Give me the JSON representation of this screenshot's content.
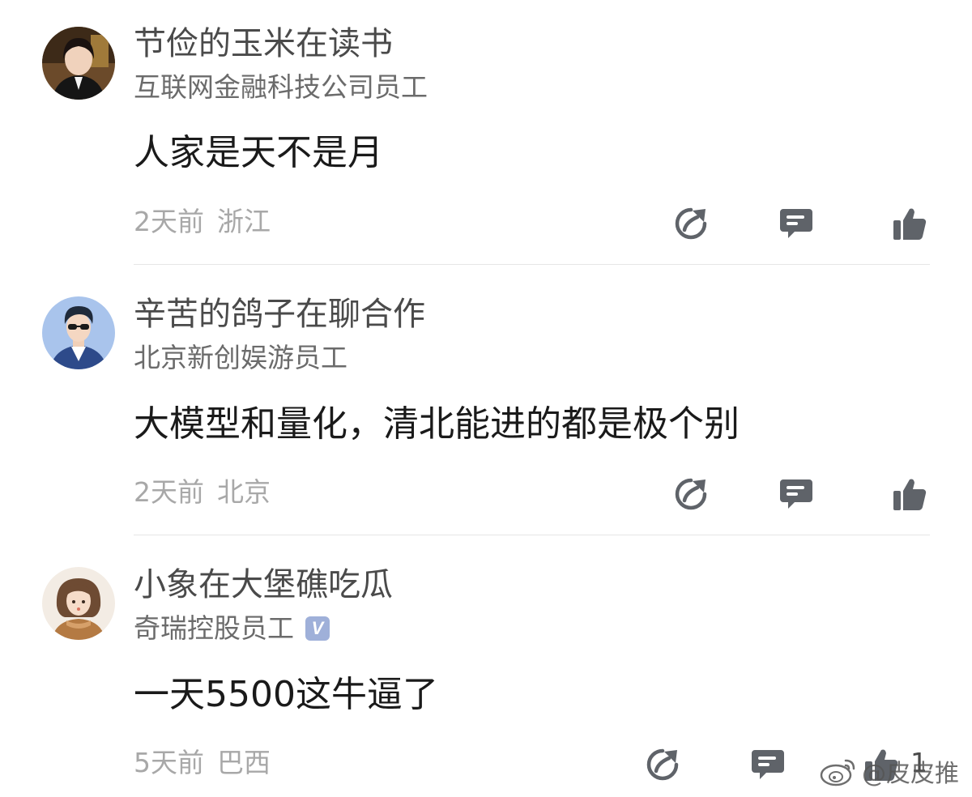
{
  "comments": [
    {
      "name": "节俭的玉米在读书",
      "title": "互联网金融科技公司员工",
      "verified": false,
      "text": "人家是天不是月",
      "time": "2天前",
      "location": "浙江",
      "likes": ""
    },
    {
      "name": "辛苦的鸽子在聊合作",
      "title": "北京新创娱游员工",
      "verified": false,
      "text": "大模型和量化，清北能进的都是极个别",
      "time": "2天前",
      "location": "北京",
      "likes": ""
    },
    {
      "name": "小象在大堡礁吃瓜",
      "title": "奇瑞控股员工",
      "verified": true,
      "badge_label": "V",
      "text": "一天5500这牛逼了",
      "time": "5天前",
      "location": "巴西",
      "likes": "1"
    }
  ],
  "icons": {
    "share": "share-icon",
    "reply": "comment-icon",
    "like": "thumbs-up-icon"
  },
  "colors": {
    "icon": "#5f6369",
    "meta": "#a8a8a8",
    "badge": "#9fb0d9"
  },
  "watermark": {
    "label": "@皮皮推"
  }
}
